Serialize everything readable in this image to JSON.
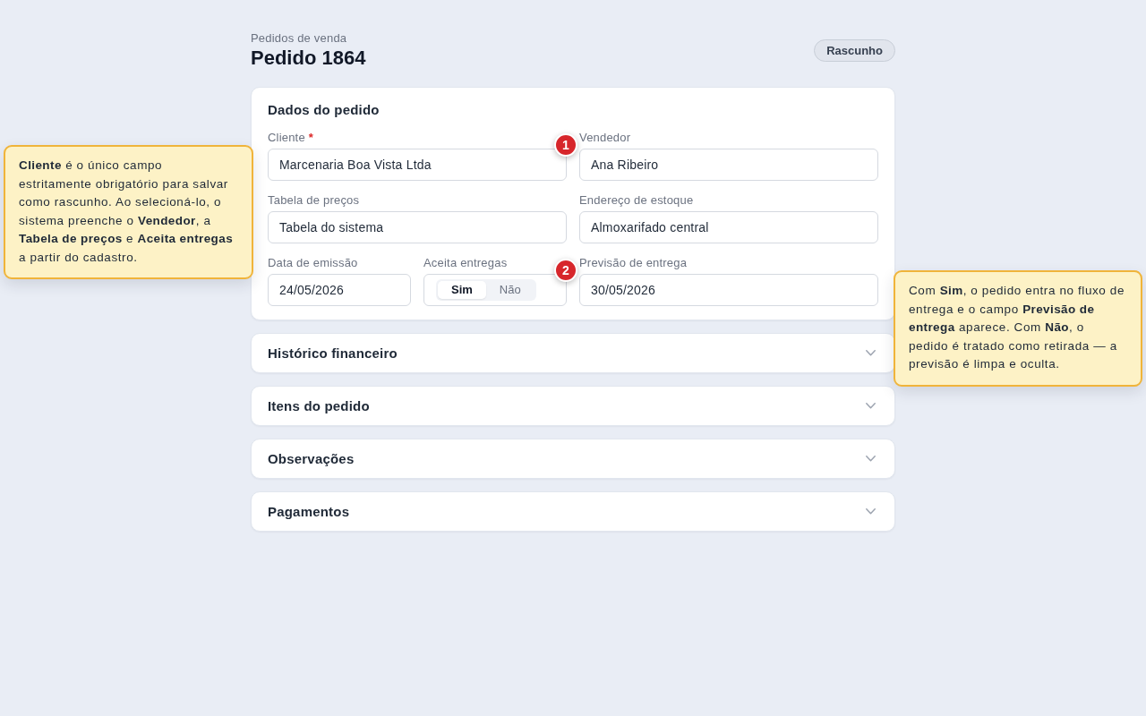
{
  "header": {
    "breadcrumb": "Pedidos de venda",
    "title": "Pedido 1864",
    "status_badge": "Rascunho"
  },
  "order_form": {
    "title": "Dados do pedido",
    "fields": [
      {
        "kind": "input",
        "label": "Cliente",
        "required_mark": "*",
        "value": "Marcenaria Boa Vista Ltda",
        "marker": "1"
      },
      {
        "kind": "input",
        "label": "Vendedor",
        "value": "Ana Ribeiro"
      },
      {
        "kind": "input",
        "label": "Tabela de preços",
        "value": "Tabela do sistema"
      },
      {
        "kind": "input",
        "label": "Endereço de estoque",
        "value": "Almoxarifado central"
      },
      {
        "kind": "input",
        "label": "Data de emissão",
        "value": "24/05/2026"
      },
      {
        "kind": "toggle",
        "label": "Aceita entregas",
        "marker": "2",
        "options": [
          {
            "label": "Sim",
            "selected": true
          },
          {
            "label": "Não",
            "selected": false
          }
        ]
      },
      {
        "kind": "input",
        "label": "Previsão de entrega",
        "value": "30/05/2026"
      }
    ]
  },
  "sections": [
    {
      "title": "Histórico financeiro",
      "expanded": false
    },
    {
      "title": "Itens do pedido",
      "expanded": false
    },
    {
      "title": "Observações",
      "expanded": false
    },
    {
      "title": "Pagamentos",
      "expanded": false
    }
  ],
  "callouts": [
    {
      "text": "**Cliente** é o único campo estritamente obrigatório para salvar como rascunho. Ao selecioná-lo, o sistema preenche o **Vendedor**, a **Tabela de preços** e **Aceita entregas** a partir do cadastro."
    },
    {
      "text": "Com **Sim**, o pedido entra no fluxo de entrega e o campo **Previsão de entrega** aparece. Com **Não**, o pedido é tratado como retirada — a previsão é limpa e oculta."
    }
  ]
}
